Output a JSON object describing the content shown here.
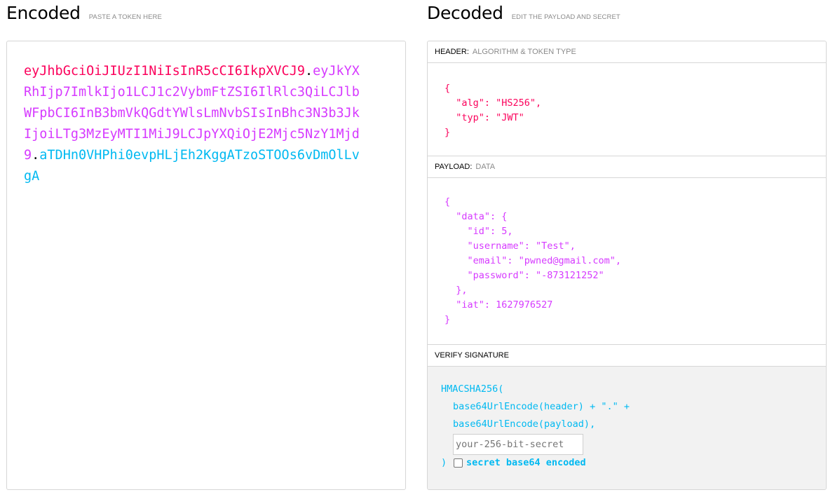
{
  "encoded": {
    "title": "Encoded",
    "subtitle": "PASTE A TOKEN HERE",
    "token": {
      "header": "eyJhbGciOiJIUzI1NiIsInR5cCI6IkpXVCJ9",
      "payload": "eyJkYXRhIjp7ImlkIjo1LCJ1c2VybmFtZSI6IlRlc3QiLCJlbWFpbCI6InB3bmVkQGdtYWlsLmNvbSIsInBhc3N3b3JkIjoiLTg3MzEyMTI1MiJ9LCJpYXQiOjE2Mjc5NzY1Mjd9",
      "signature": "aTDHn0VHPhi0evpHLjEh2KggATzoSTOOs6vDmOlLvgA",
      "dot": "."
    }
  },
  "decoded": {
    "title": "Decoded",
    "subtitle": "EDIT THE PAYLOAD AND SECRET",
    "header_section": {
      "label": "HEADER:",
      "sublabel": "ALGORITHM & TOKEN TYPE",
      "json_text": "{\n  \"alg\": \"HS256\",\n  \"typ\": \"JWT\"\n}"
    },
    "payload_section": {
      "label": "PAYLOAD:",
      "sublabel": "DATA",
      "json_text": "{\n  \"data\": {\n    \"id\": 5,\n    \"username\": \"Test\",\n    \"email\": \"pwned@gmail.com\",\n    \"password\": \"-873121252\"\n  },\n  \"iat\": 1627976527\n}"
    },
    "verify_section": {
      "label": "VERIFY SIGNATURE",
      "line1": "HMACSHA256(",
      "line2": "base64UrlEncode(header) + \".\" +",
      "line3": "base64UrlEncode(payload),",
      "secret_placeholder": "your-256-bit-secret",
      "close_paren": ")",
      "checkbox_label": "secret base64 encoded"
    }
  },
  "colors": {
    "header": "#fb015b",
    "payload": "#d63aff",
    "signature": "#00b9f1"
  }
}
